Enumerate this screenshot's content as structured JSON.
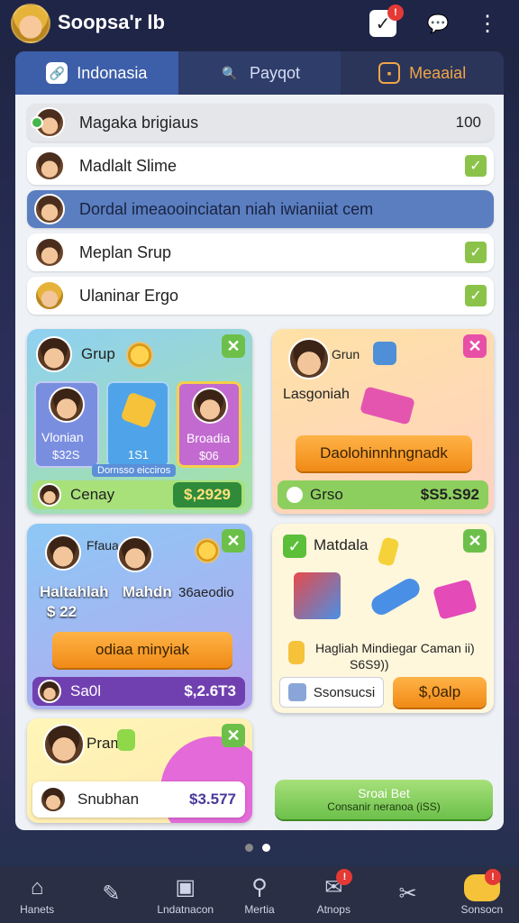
{
  "header": {
    "title": "Soopsa'r lb",
    "notification_badge": "!",
    "profile_badge": "!"
  },
  "tabs": [
    {
      "label": "Indonasia",
      "icon": "link-icon"
    },
    {
      "label": "Payqot",
      "icon": "search-icon"
    },
    {
      "label": "Meaaial",
      "icon": "square-icon"
    }
  ],
  "list": [
    {
      "label": "Magaka brigiaus",
      "value": "100"
    },
    {
      "label": "Madlalt Slime"
    },
    {
      "label": "Dordal imeaooinciatan niah iwianiiat cem"
    },
    {
      "label": "Meplan Srup"
    },
    {
      "label": "Ulaninar Ergo"
    }
  ],
  "cards": {
    "grup_left": {
      "title": "Grup",
      "items": [
        {
          "name": "Vlonian",
          "price": "$32S"
        },
        {
          "name": "",
          "price": "1S1"
        },
        {
          "name": "Broadia",
          "price": "$06"
        }
      ],
      "caption": "Dornsso eicciros",
      "bar_label": "Cenay",
      "bar_price": "$,2929"
    },
    "grup_right": {
      "title": "Grun",
      "subtitle": "Lasgoniah",
      "button": "Daolohinnhngnadk",
      "bar_label": "Grso",
      "bar_price": "$S5.S92"
    },
    "hadiah": {
      "title": "Ffaua",
      "label_left": "Haltahlah",
      "label_mid": "Mahdn",
      "label_right": "36aeodio",
      "price": "$ 22",
      "button": "odiaa minyiak",
      "bar_label": "Sa0l",
      "bar_price": "$,2.6T3"
    },
    "matdala": {
      "title": "Matdala",
      "description_1": "Hagliah Mindiegar Caman ii)",
      "description_2": "S6S9))",
      "secondary_button": "Ssonsucsi",
      "price_button": "$,0alp"
    },
    "pram": {
      "title": "Pram",
      "bar_label": "Snubhan",
      "bar_price": "$3.577"
    },
    "green_button": {
      "line1": "Sroai Bet",
      "line2": "Consanir neranoa (iSS)"
    }
  },
  "bottom_nav": [
    {
      "label": "Hanets",
      "icon": "home-icon"
    },
    {
      "label": "",
      "icon": "tools-icon"
    },
    {
      "label": "Lndatnacon",
      "icon": "box-icon"
    },
    {
      "label": "Mertia",
      "icon": "search-icon"
    },
    {
      "label": "Atnops",
      "icon": "shop-icon",
      "badge": "!"
    },
    {
      "label": "",
      "icon": "scissors-icon"
    },
    {
      "label": "Sonsocn",
      "icon": "profile-icon",
      "badge": "!"
    }
  ],
  "colors": {
    "accent_blue": "#3d5ea8",
    "orange": "#f08a16",
    "green": "#6cc04a"
  }
}
